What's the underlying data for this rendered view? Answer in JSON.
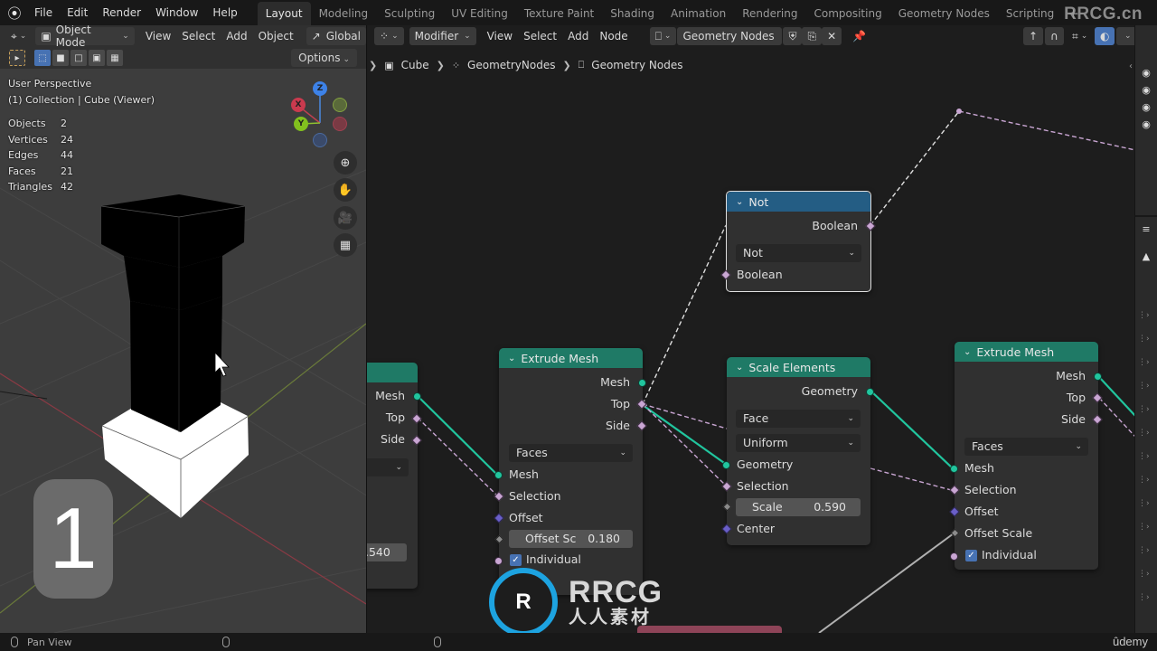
{
  "topbar": {
    "menus": [
      "File",
      "Edit",
      "Render",
      "Window",
      "Help"
    ],
    "workspaces": [
      "Layout",
      "Modeling",
      "Sculpting",
      "UV Editing",
      "Texture Paint",
      "Shading",
      "Animation",
      "Rendering",
      "Compositing",
      "Geometry Nodes",
      "Scripting"
    ],
    "active_workspace": "Layout",
    "add_tab": "+",
    "watermark": "RRCG.cn"
  },
  "viewport": {
    "mode": "Object Mode",
    "menus": [
      "View",
      "Select",
      "Add",
      "Object"
    ],
    "transform_orientation": "Global",
    "options_label": "Options",
    "perspective_label": "User Perspective",
    "collection_label": "(1) Collection | Cube (Viewer)",
    "stats": [
      {
        "label": "Objects",
        "value": "2"
      },
      {
        "label": "Vertices",
        "value": "24"
      },
      {
        "label": "Edges",
        "value": "44"
      },
      {
        "label": "Faces",
        "value": "21"
      },
      {
        "label": "Triangles",
        "value": "42"
      }
    ],
    "gizmo": {
      "x": "X",
      "y": "Y",
      "z": "Z"
    },
    "overlay_number": "1"
  },
  "node_editor": {
    "context": "Modifier",
    "menus": [
      "View",
      "Select",
      "Add",
      "Node"
    ],
    "node_group": "Geometry Nodes",
    "breadcrumb": [
      "Cube",
      "GeometryNodes",
      "Geometry Nodes"
    ],
    "nodes": {
      "partial": {
        "outputs": [
          "Mesh",
          "Top",
          "Side"
        ],
        "value": ".540"
      },
      "extrude1": {
        "title": "Extrude Mesh",
        "outputs": [
          "Mesh",
          "Top",
          "Side"
        ],
        "mode": "Faces",
        "inputs": [
          "Mesh",
          "Selection",
          "Offset"
        ],
        "offset_scale_label": "Offset Sc",
        "offset_scale_value": "0.180",
        "individual_label": "Individual",
        "individual_checked": true
      },
      "not": {
        "title": "Not",
        "output": "Boolean",
        "operation": "Not",
        "input": "Boolean"
      },
      "scale": {
        "title": "Scale Elements",
        "output": "Geometry",
        "domain": "Face",
        "scale_mode": "Uniform",
        "inputs": [
          "Geometry",
          "Selection"
        ],
        "scale_label": "Scale",
        "scale_value": "0.590",
        "center_label": "Center"
      },
      "extrude2": {
        "title": "Extrude Mesh",
        "outputs": [
          "Mesh",
          "Top",
          "Side"
        ],
        "mode": "Faces",
        "inputs": [
          "Mesh",
          "Selection",
          "Offset",
          "Offset Scale"
        ],
        "individual_label": "Individual",
        "individual_checked": true
      }
    }
  },
  "statusbar": {
    "left_hint": "Pan View",
    "brand": "ûdemy"
  },
  "watermark_logo": {
    "line1": "RRCG",
    "line2": "人人素材",
    "badge": "R"
  },
  "colors": {
    "geometry_header": "#1f7a66",
    "boolean_header": "#245d84",
    "geometry_socket": "#21c59e",
    "boolean_socket": "#c9a6d3",
    "vector_socket": "#6a5fc8",
    "accent_blue": "#4772b3"
  }
}
